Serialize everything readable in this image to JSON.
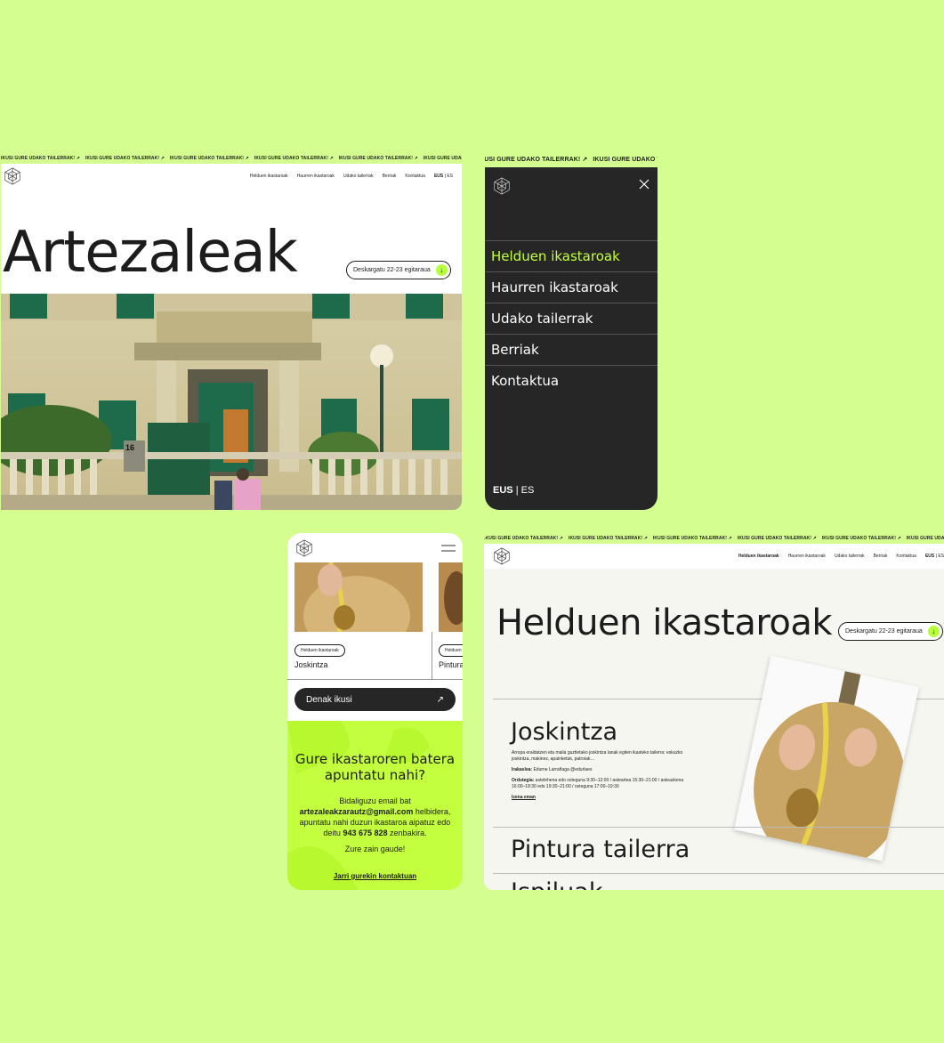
{
  "ticker": {
    "text": "IKUSI GURE UDAKO TAILERRAK!",
    "arrow": "↗"
  },
  "nav": {
    "items": [
      "Helduen ikastaroak",
      "Haurren ikastaroak",
      "Udako tailerrak",
      "Berriak",
      "Kontaktua"
    ],
    "lang_active": "EUS",
    "lang_sep": "|",
    "lang_other": "ES"
  },
  "home": {
    "title": "Artezaleak",
    "download_label": "Deskargatu 22-23 egitaraua",
    "download_icon": "↓",
    "house_number": "16"
  },
  "mobile_menu": {
    "items": [
      "Helduen ikastaroak",
      "Haurren ikastaroak",
      "Udako tailerrak",
      "Berriak",
      "Kontaktua"
    ],
    "active_index": 0
  },
  "mobile": {
    "cards": [
      {
        "tag": "Helduen ikastaroak",
        "title": "Joskintza"
      },
      {
        "tag": "Helduen ikastaroak",
        "title": "Pintura tailerra"
      }
    ],
    "see_all_label": "Denak ikusi",
    "see_all_icon": "↗",
    "cta": {
      "title": "Gure ikastaroren batera apuntatu nahi?",
      "text_1": "Bidaliguzu email bat",
      "email": "artezaleakzarautz@gmail.com",
      "text_2": "helbidera, apuntatu nahi duzun ikastaroa aipatuz edo deitu",
      "phone": "943 675 828",
      "text_3": "zenbakira.",
      "closing": "Zure zain gaude!",
      "link": "Jarri gurekin kontaktuan"
    }
  },
  "course_page": {
    "title": "Helduen ikastaroak",
    "download_label": "Deskargatu 22-23 egitaraua",
    "download_icon": "↓",
    "courses": [
      {
        "title": "Joskintza",
        "description": "Arropa eraldatzen eta maila guztietako joskintza lanak egiten ikasteko tailerra: eskuzko joskintza, makinez, apainketak, patroiak…",
        "teacher_label": "Irakaslea:",
        "teacher": "Edurne Larrañaga @edurlaes",
        "schedule_label": "Ordutegia:",
        "schedule": "astelehena edo osteguna 9:30–12:00 / astearteа 15:30–21:00 / asteazkena 16:00–18:30 edo 19:30–21:00 / osteguna 17:00–19:30",
        "link": "Izena eman"
      },
      {
        "title": "Pintura tailerra"
      },
      {
        "title": "Ispiluak"
      }
    ]
  },
  "colors": {
    "background": "#d4ff90",
    "accent": "#c4ff3f",
    "dark": "#262626"
  }
}
